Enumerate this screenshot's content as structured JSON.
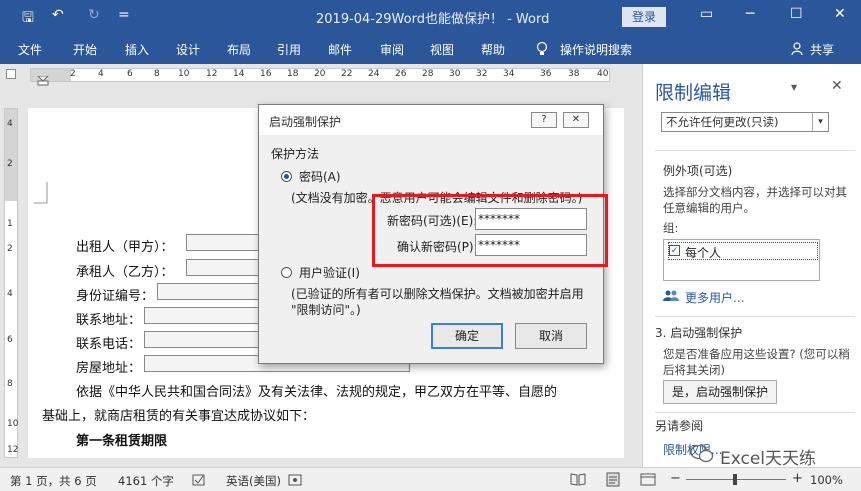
{
  "titlebar": {
    "title": "2019-04-29Word也能做保护！ - Word",
    "login": "登录",
    "save_icon": "🖫",
    "undo": "↶",
    "redo": "↻",
    "customize": "=",
    "ribbon_opts": "▭",
    "minimize": "─",
    "maximize": "☐",
    "close": "✕"
  },
  "menu": {
    "tabs": [
      "文件",
      "开始",
      "插入",
      "设计",
      "布局",
      "引用",
      "邮件",
      "审阅",
      "视图",
      "帮助"
    ],
    "tellme": "操作说明搜索",
    "share": "共享"
  },
  "ruler": {
    "ticks": [
      "2",
      "2",
      "4",
      "6",
      "8",
      "10",
      "12",
      "14",
      "16",
      "18",
      "20",
      "22",
      "24",
      "26",
      "28",
      "30",
      "32",
      "34",
      "36",
      "38",
      "40"
    ],
    "vticks": [
      "4",
      "2",
      "1",
      "2",
      "4",
      "6",
      "8",
      "10",
      "12"
    ]
  },
  "document": {
    "lines": [
      "出租人（甲方）：",
      "承租人（乙方）：",
      "身份证编号：",
      "联系地址：",
      "联系电话：",
      "房屋地址："
    ],
    "para1": "依据《中华人民共和国合同法》及有关法律、法规的规定，甲乙双方在平等、自愿的",
    "para2": "基础上，就商店租赁的有关事宜达成协议如下：",
    "heading": "第一条租赁期限"
  },
  "dialog": {
    "title": "启动强制保护",
    "help": "?",
    "close": "✕",
    "section": "保护方法",
    "option_password": "密码(A)",
    "password_note": "(文档没有加密。恶意用户可能会编辑文件和删除密码。)",
    "new_pwd_label": "新密码(可选)(E):",
    "new_pwd_value": "*******",
    "confirm_pwd_label": "确认新密码(P):",
    "confirm_pwd_value": "*******",
    "option_user": "用户验证(I)",
    "user_note_1": "(已验证的所有者可以删除文档保护。文档被加密并启用",
    "user_note_2": "\"限制访问\"。)",
    "ok": "确定",
    "cancel": "取消"
  },
  "sidepanel": {
    "title": "限制编辑",
    "dropdown": "▾",
    "close": "✕",
    "select_value": "不允许任何更改(只读)",
    "exceptions_heading": "例外项(可选)",
    "exceptions_text": "选择部分文档内容，并选择可以对其任意编辑的用户。",
    "groups_label": "组:",
    "group_item": "每个人",
    "more_users": "更多用户...",
    "step3_heading": "3. 启动强制保护",
    "step3_text": "您是否准备应用这些设置? (您可以稍后将其关闭)",
    "start_button": "是，启动强制保护",
    "see_also": "另请参阅",
    "see_also_link": "限制权限..."
  },
  "statusbar": {
    "page": "第 1 页，共 6 页",
    "words": "4161 个字",
    "language": "英语(美国)",
    "zoom": "100%",
    "zoom_minus": "−",
    "zoom_plus": "+"
  },
  "watermark": "Excel天天练",
  "colors": {
    "brand": "#2b579a",
    "highlight": "#e8191c"
  }
}
